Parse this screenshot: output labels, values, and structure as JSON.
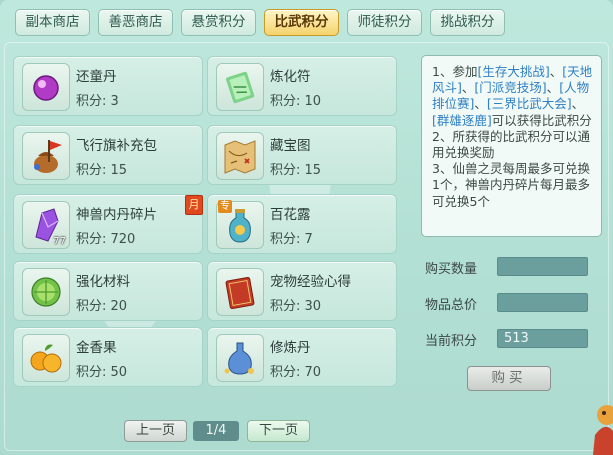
{
  "tabs": [
    {
      "label": "副本商店",
      "active": false
    },
    {
      "label": "善恶商店",
      "active": false
    },
    {
      "label": "悬赏积分",
      "active": false
    },
    {
      "label": "比武积分",
      "active": true
    },
    {
      "label": "师徒积分",
      "active": false
    },
    {
      "label": "挑战积分",
      "active": false
    }
  ],
  "items": [
    {
      "name": "还童丹",
      "points": "积分: 3",
      "icon": "purple-orb-pill-icon"
    },
    {
      "name": "炼化符",
      "points": "积分: 10",
      "icon": "green-talisman-icon"
    },
    {
      "name": "飞行旗补充包",
      "points": "积分: 15",
      "icon": "flag-pouch-icon"
    },
    {
      "name": "藏宝图",
      "points": "积分: 15",
      "icon": "treasure-map-icon"
    },
    {
      "name": "神兽内丹碎片",
      "points": "积分: 720",
      "icon": "purple-crystal-shard-icon",
      "badge": "月",
      "stack": "77"
    },
    {
      "name": "百花露",
      "points": "积分: 7",
      "icon": "flower-dew-bottle-icon",
      "tag": "专"
    },
    {
      "name": "强化材料",
      "points": "积分: 20",
      "icon": "green-cabbage-material-icon"
    },
    {
      "name": "宠物经验心得",
      "points": "积分: 30",
      "icon": "red-book-icon"
    },
    {
      "name": "金香果",
      "points": "积分: 50",
      "icon": "golden-fruit-icon"
    },
    {
      "name": "修炼丹",
      "points": "积分: 70",
      "icon": "elixir-vase-icon"
    }
  ],
  "info": {
    "p1a": "1、参加",
    "l1": "[生存大挑战]",
    "p1b": "、",
    "l2": "[天地风斗]",
    "p1c": "、",
    "l3": "[门派竞技场]",
    "p1d": "、",
    "l4": "[人物排位赛]",
    "p1e": "、",
    "l5": "[三界比武大会]",
    "p1f": "、",
    "l6": "[群雄逐鹿]",
    "p1g": "可以获得比武积分",
    "p2": "2、所获得的比武积分可以通用兑换奖励",
    "p3": "3、仙兽之灵每周最多可兑换1个，神兽内丹碎片每月最多可兑换5个"
  },
  "purchase": {
    "qty_label": "购买数量",
    "qty_value": "",
    "total_label": "物品总价",
    "total_value": "",
    "current_label": "当前积分",
    "current_value": "513",
    "buy_label": "购买"
  },
  "pager": {
    "prev_label": "上一页",
    "page": "1/4",
    "next_label": "下一页"
  },
  "colors": {
    "panel_bg": "#b3e0d4",
    "active_tab": "#f5d36b",
    "link_blue": "#2e7fc4",
    "field_bg": "#6b9f9e"
  }
}
